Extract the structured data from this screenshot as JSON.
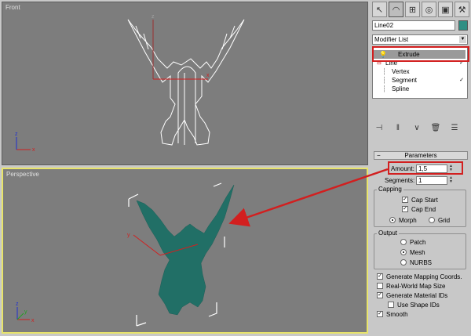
{
  "viewports": {
    "front_label": "Front",
    "perspective_label": "Perspective",
    "axis_x": "x",
    "axis_y": "y",
    "axis_z": "z"
  },
  "panel": {
    "tabs": [
      "create-icon",
      "modify-icon",
      "hierarchy-icon",
      "motion-icon",
      "display-icon",
      "utilities-icon"
    ],
    "object_name": "Line02",
    "object_color": "#2f8f84",
    "modifier_list_label": "Modifier List",
    "stack": {
      "extrude": "Extrude",
      "line": "Line",
      "vertex": "Vertex",
      "segment": "Segment",
      "spline": "Spline"
    },
    "parameters_title": "Parameters",
    "amount_label": "Amount:",
    "amount_value": "1,5",
    "segments_label": "Segments:",
    "segments_value": "1",
    "capping": {
      "title": "Capping",
      "cap_start": "Cap Start",
      "cap_end": "Cap End",
      "morph": "Morph",
      "grid": "Grid"
    },
    "output": {
      "title": "Output",
      "patch": "Patch",
      "mesh": "Mesh",
      "nurbs": "NURBS"
    },
    "options": {
      "gen_mapping": "Generate Mapping Coords.",
      "real_world": "Real-World Map Size",
      "gen_material": "Generate Material IDs",
      "use_shape": "Use Shape IDs",
      "smooth": "Smooth"
    }
  },
  "colors": {
    "highlight": "#d21f1f",
    "extrude_fill": "#216f66",
    "active_viewport": "#e8e46a"
  }
}
